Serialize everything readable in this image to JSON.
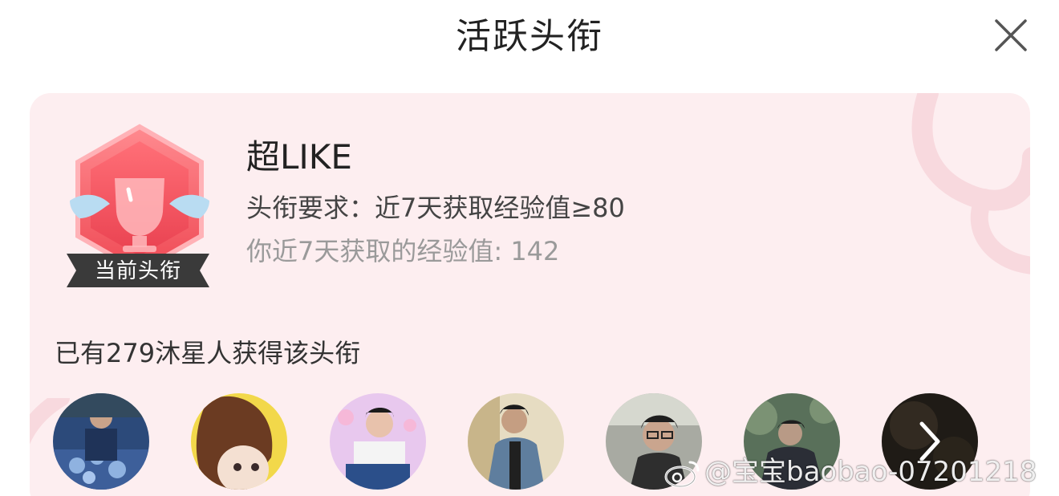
{
  "header": {
    "title": "活跃头衔",
    "close_icon": "close-icon"
  },
  "title_card": {
    "badge_icon": "trophy-winged-icon",
    "badge_ribbon": "当前头衔",
    "name": "超LIKE",
    "requirement": "头衔要求：近7天获取经验值≥80",
    "user_exp": "你近7天获取的经验值: 142",
    "holders_text": "已有279沐星人获得该头衔",
    "colors": {
      "card_bg": "#fdeef0",
      "badge_red": "#f2525b",
      "ribbon_dark": "#3a3a3a"
    }
  },
  "avatars": [
    {
      "name": "holder-1"
    },
    {
      "name": "holder-2"
    },
    {
      "name": "holder-3"
    },
    {
      "name": "holder-4"
    },
    {
      "name": "holder-5"
    },
    {
      "name": "holder-6"
    },
    {
      "name": "holder-7-more",
      "icon": "chevron-right-icon"
    }
  ],
  "watermark": {
    "logo_icon": "weibo-icon",
    "text": "@宝宝baobao-07201218"
  }
}
